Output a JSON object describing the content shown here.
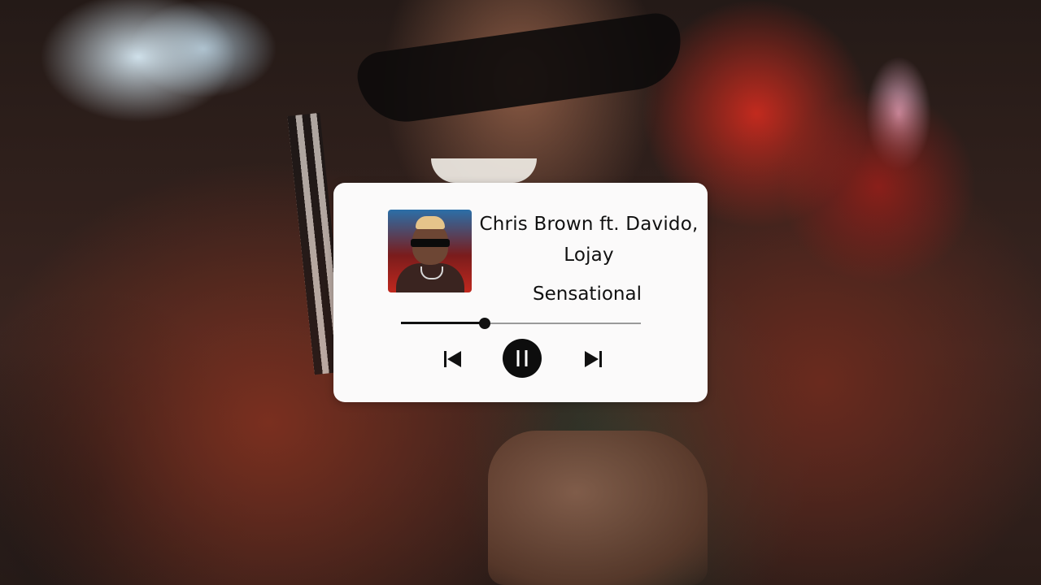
{
  "player": {
    "artist": "Chris Brown ft. Davido, Lojay",
    "title": "Sensational",
    "progress": 0.35,
    "state": "playing",
    "icons": {
      "previous": "skip-previous-icon",
      "pause": "pause-icon",
      "next": "skip-next-icon"
    },
    "colors": {
      "card_background": "#fbfafa",
      "accent": "#111111",
      "track": "#9a9a9a"
    }
  }
}
